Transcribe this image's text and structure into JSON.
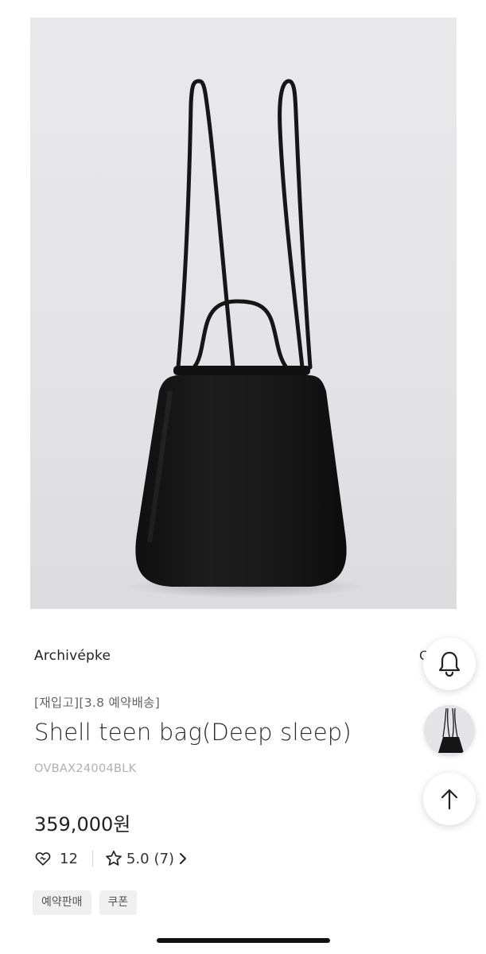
{
  "product": {
    "image_alt": "Shell teen bag black backpack",
    "brand": "Archivépke",
    "brand_extra": "C",
    "promo": "[재입고][3.8 예약배송]",
    "title": "Shell teen bag(Deep sleep)",
    "sku": "OVBAX24004BLK",
    "price": "359,000원",
    "likes": "12",
    "rating": "5.0",
    "review_count": "(7)",
    "tags": [
      "예약판매",
      "쿠폰"
    ]
  },
  "floating": {
    "notify_icon": "bell-icon",
    "thumbnail_icon": "product-thumbnail",
    "scroll_top_icon": "arrow-up-icon"
  },
  "colors": {
    "bag": "#141414",
    "background": "#e6e6e8",
    "text_primary": "#222222",
    "text_muted": "#b0b0b0"
  }
}
